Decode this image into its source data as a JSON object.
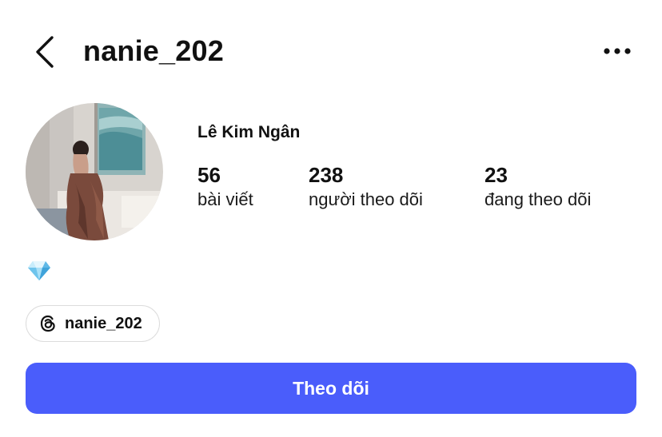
{
  "header": {
    "username": "nanie_202",
    "back_icon": "chevron-left-icon",
    "more_icon": "more-horizontal-icon"
  },
  "profile": {
    "display_name": "Lê Kim Ngân",
    "avatar": "profile-photo",
    "stats": [
      {
        "value": "56",
        "label": "bài viết"
      },
      {
        "value": "238",
        "label": "người theo dõi"
      },
      {
        "value": "23",
        "label": "đang theo dõi"
      }
    ],
    "bio_icon": "gem-icon",
    "threads": {
      "icon": "threads-icon",
      "handle": "nanie_202"
    }
  },
  "actions": {
    "follow_label": "Theo dõi"
  },
  "colors": {
    "accent": "#4a5dfb",
    "chip_border": "#dcdcdc"
  }
}
